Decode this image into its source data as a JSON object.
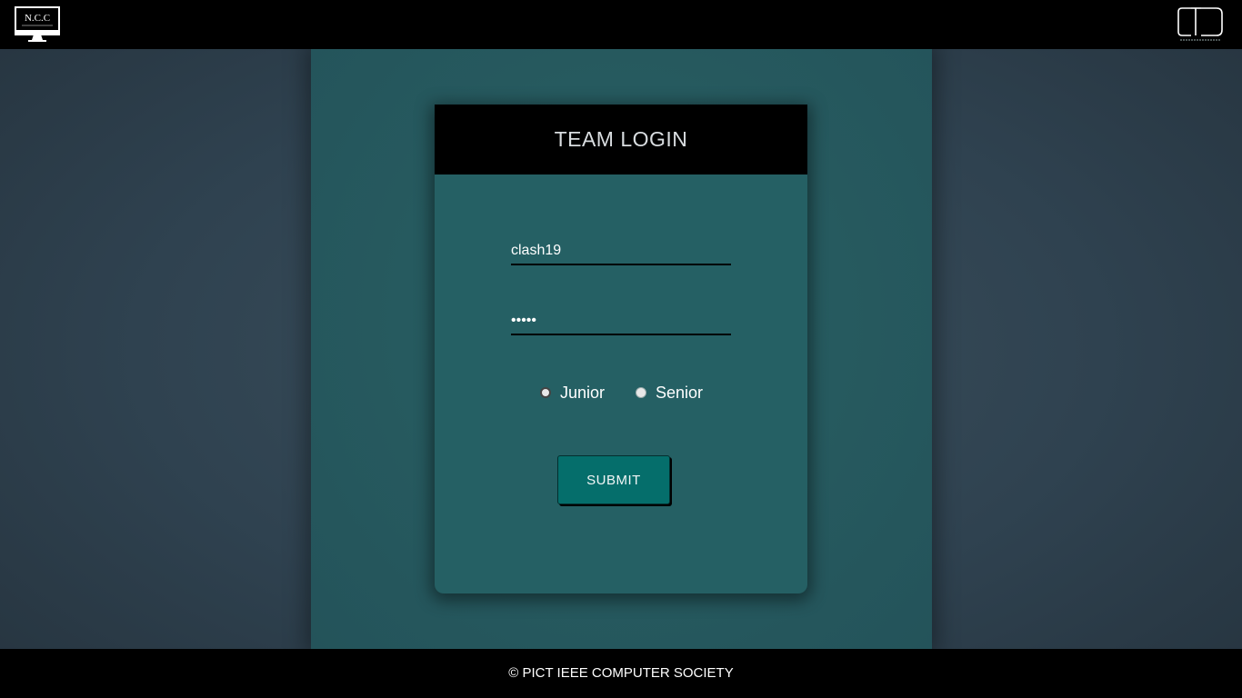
{
  "header": {
    "left_logo": {
      "text": "N.C.C",
      "icon": "monitor-logo-icon"
    },
    "right_logo": {
      "icon": "credenz-logo-icon"
    }
  },
  "login": {
    "title": "TEAM LOGIN",
    "username_value": "clash19",
    "password_value": "•••••",
    "radio_options": [
      {
        "label": "Junior",
        "checked": true
      },
      {
        "label": "Senior",
        "checked": false
      }
    ],
    "submit_label": "SUBMIT"
  },
  "footer": {
    "text": "© PICT IEEE COMPUTER SOCIETY"
  },
  "colors": {
    "topbar": "#000000",
    "panel": "#265a5f",
    "card": "#256064",
    "button": "#056e6b"
  }
}
